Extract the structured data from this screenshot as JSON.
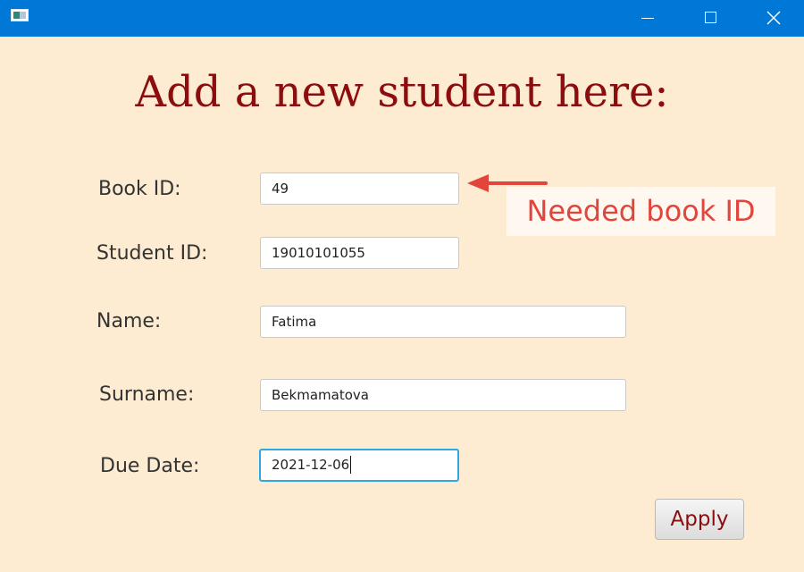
{
  "window": {
    "controls": {
      "minimize_icon": "minimize-icon",
      "maximize_icon": "maximize-icon",
      "close_icon": "close-icon"
    }
  },
  "page": {
    "title": "Add a new student here:"
  },
  "form": {
    "book_id": {
      "label": "Book ID:",
      "value": "49"
    },
    "student_id": {
      "label": "Student ID:",
      "value": "19010101055"
    },
    "name": {
      "label": "Name:",
      "value": "Fatima"
    },
    "surname": {
      "label": "Surname:",
      "value": "Bekmamatova"
    },
    "due_date": {
      "label": "Due Date:",
      "value": "2021-12-06"
    },
    "apply_label": "Apply"
  },
  "annotation": {
    "text": "Needed book ID",
    "color": "#e2453c"
  },
  "colors": {
    "titlebar": "#0078d7",
    "background": "#fdebd2",
    "heading": "#8b0d0d",
    "focus": "#2fa8e0"
  }
}
